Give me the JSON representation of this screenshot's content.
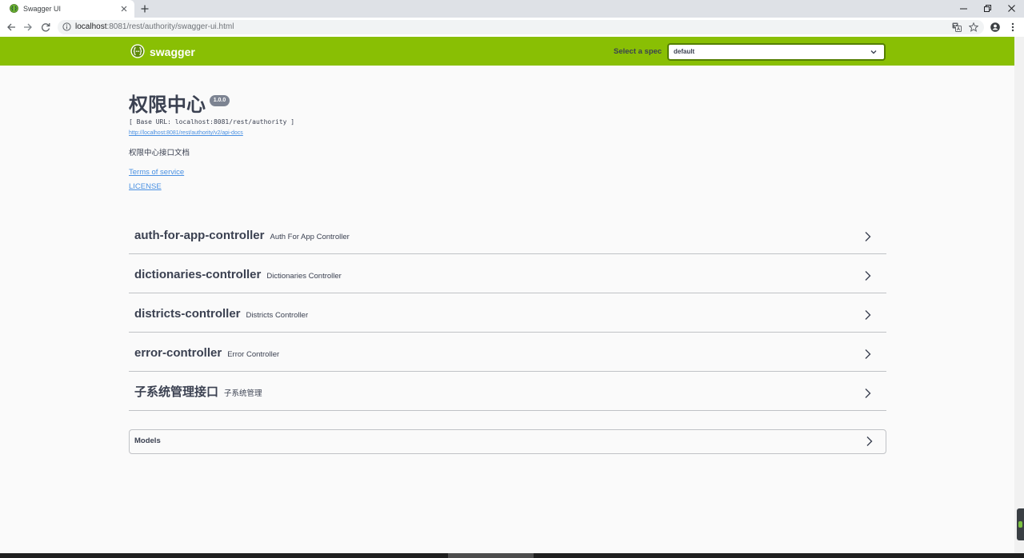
{
  "browser": {
    "tab_title": "Swagger UI",
    "url": {
      "host": "localhost",
      "rest": ":8081/rest/authority/swagger-ui.html"
    }
  },
  "topbar": {
    "brand": "swagger",
    "spec_label": "Select a spec",
    "spec_selected": "default"
  },
  "info": {
    "title": "权限中心",
    "version": "1.0.0",
    "base_url": "[ Base URL: localhost:8081/rest/authority ]",
    "api_docs_url": "http://localhost:8081/rest/authority/v2/api-docs",
    "description": "权限中心接口文档",
    "terms_of_service": "Terms of service",
    "license": "LICENSE"
  },
  "tags": [
    {
      "name": "auth-for-app-controller",
      "description": "Auth For App Controller"
    },
    {
      "name": "dictionaries-controller",
      "description": "Dictionaries Controller"
    },
    {
      "name": "districts-controller",
      "description": "Districts Controller"
    },
    {
      "name": "error-controller",
      "description": "Error Controller"
    },
    {
      "name": "子系统管理接口",
      "description": "子系统管理"
    }
  ],
  "models": {
    "label": "Models"
  },
  "colors": {
    "topbar": "#89bf04",
    "select_border": "#547f00",
    "link": "#4990e2",
    "text": "#3b4151",
    "version_badge": "#7d8492",
    "page_background": "#fafafa"
  },
  "icons": [
    "swagger-favicon-icon",
    "close-icon",
    "new-tab-icon",
    "minimize-icon",
    "restore-icon",
    "window-close-icon",
    "back-arrow-icon",
    "forward-arrow-icon",
    "reload-icon",
    "info-icon",
    "translate-icon",
    "star-icon",
    "account-icon",
    "menu-icon",
    "swagger-logo-icon",
    "chevron-down-icon",
    "chevron-right-icon"
  ]
}
